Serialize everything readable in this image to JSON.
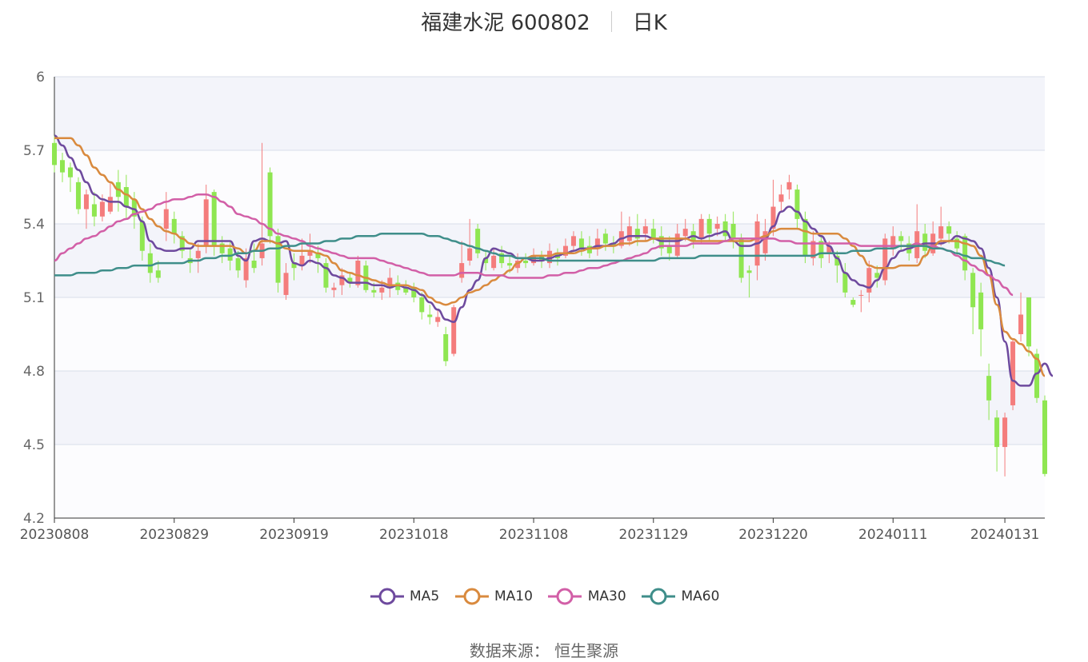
{
  "header": {
    "title": "福建水泥 600802",
    "period": "日K"
  },
  "footer": {
    "source": "数据来源： 恒生聚源"
  },
  "colors": {
    "up": "#f47c7c",
    "down": "#8fe651",
    "ma5": "#6e4a9e",
    "ma10": "#d98a3e",
    "ma30": "#d25fa7",
    "ma60": "#3f8e8a",
    "grid": "#d9deea",
    "band": "#f3f4fa"
  },
  "chart_data": {
    "type": "candlestick",
    "title": "福建水泥 600802",
    "subtitle": "日K",
    "ylim": [
      4.2,
      6.0
    ],
    "yticks": [
      "6",
      "5.7",
      "5.4",
      "5.1",
      "4.8",
      "4.5",
      "4.2"
    ],
    "xticks": [
      {
        "index": 0,
        "label": "20230808"
      },
      {
        "index": 15,
        "label": "20230829"
      },
      {
        "index": 30,
        "label": "20230919"
      },
      {
        "index": 45,
        "label": "20231018"
      },
      {
        "index": 60,
        "label": "20231108"
      },
      {
        "index": 75,
        "label": "20231129"
      },
      {
        "index": 90,
        "label": "20231220"
      },
      {
        "index": 105,
        "label": "20240111"
      },
      {
        "index": 119,
        "label": "20240131"
      }
    ],
    "candles": [
      [
        5.73,
        5.64,
        5.76,
        5.61
      ],
      [
        5.66,
        5.61,
        5.69,
        5.57
      ],
      [
        5.63,
        5.59,
        5.65,
        5.53
      ],
      [
        5.57,
        5.46,
        5.59,
        5.44
      ],
      [
        5.46,
        5.52,
        5.54,
        5.38
      ],
      [
        5.48,
        5.43,
        5.53,
        5.39
      ],
      [
        5.43,
        5.49,
        5.52,
        5.41
      ],
      [
        5.45,
        5.51,
        5.57,
        5.44
      ],
      [
        5.57,
        5.51,
        5.62,
        5.45
      ],
      [
        5.55,
        5.47,
        5.6,
        5.42
      ],
      [
        5.5,
        5.43,
        5.53,
        5.38
      ],
      [
        5.41,
        5.29,
        5.43,
        5.25
      ],
      [
        5.28,
        5.2,
        5.32,
        5.16
      ],
      [
        5.21,
        5.18,
        5.25,
        5.16
      ],
      [
        5.38,
        5.46,
        5.53,
        5.33
      ],
      [
        5.42,
        5.36,
        5.45,
        5.32
      ],
      [
        5.35,
        5.29,
        5.37,
        5.26
      ],
      [
        5.26,
        5.24,
        5.3,
        5.2
      ],
      [
        5.26,
        5.29,
        5.32,
        5.2
      ],
      [
        5.31,
        5.5,
        5.56,
        5.28
      ],
      [
        5.53,
        5.31,
        5.54,
        5.27
      ],
      [
        5.32,
        5.28,
        5.35,
        5.24
      ],
      [
        5.3,
        5.25,
        5.33,
        5.21
      ],
      [
        5.26,
        5.21,
        5.29,
        5.18
      ],
      [
        5.17,
        5.26,
        5.3,
        5.14
      ],
      [
        5.25,
        5.22,
        5.32,
        5.2
      ],
      [
        5.26,
        5.32,
        5.73,
        5.23
      ],
      [
        5.61,
        5.35,
        5.63,
        5.32
      ],
      [
        5.35,
        5.16,
        5.38,
        5.12
      ],
      [
        5.11,
        5.2,
        5.24,
        5.09
      ],
      [
        5.24,
        5.22,
        5.28,
        5.17
      ],
      [
        5.23,
        5.27,
        5.34,
        5.21
      ],
      [
        5.27,
        5.29,
        5.36,
        5.24
      ],
      [
        5.28,
        5.26,
        5.31,
        5.2
      ],
      [
        5.24,
        5.14,
        5.26,
        5.12
      ],
      [
        5.13,
        5.14,
        5.16,
        5.1
      ],
      [
        5.15,
        5.19,
        5.22,
        5.11
      ],
      [
        5.18,
        5.16,
        5.2,
        5.14
      ],
      [
        5.15,
        5.25,
        5.27,
        5.14
      ],
      [
        5.23,
        5.13,
        5.25,
        5.12
      ],
      [
        5.13,
        5.12,
        5.16,
        5.1
      ],
      [
        5.12,
        5.14,
        5.17,
        5.09
      ],
      [
        5.14,
        5.18,
        5.22,
        5.1
      ],
      [
        5.16,
        5.13,
        5.19,
        5.11
      ],
      [
        5.14,
        5.12,
        5.17,
        5.11
      ],
      [
        5.14,
        5.1,
        5.16,
        5.08
      ],
      [
        5.1,
        5.04,
        5.12,
        5.01
      ],
      [
        5.03,
        5.02,
        5.07,
        4.99
      ],
      [
        5.0,
        5.02,
        5.05,
        4.98
      ],
      [
        4.95,
        4.84,
        4.98,
        4.82
      ],
      [
        4.87,
        5.06,
        5.07,
        4.86
      ],
      [
        5.18,
        5.24,
        5.33,
        5.16
      ],
      [
        5.25,
        5.3,
        5.42,
        5.23
      ],
      [
        5.38,
        5.28,
        5.4,
        5.26
      ],
      [
        5.26,
        5.24,
        5.29,
        5.21
      ],
      [
        5.22,
        5.27,
        5.3,
        5.21
      ],
      [
        5.28,
        5.24,
        5.31,
        5.22
      ],
      [
        5.24,
        5.23,
        5.27,
        5.2
      ],
      [
        5.22,
        5.25,
        5.28,
        5.2
      ],
      [
        5.25,
        5.24,
        5.28,
        5.22
      ],
      [
        5.24,
        5.27,
        5.3,
        5.23
      ],
      [
        5.27,
        5.25,
        5.29,
        5.22
      ],
      [
        5.24,
        5.29,
        5.32,
        5.22
      ],
      [
        5.28,
        5.26,
        5.3,
        5.23
      ],
      [
        5.27,
        5.31,
        5.34,
        5.26
      ],
      [
        5.31,
        5.35,
        5.37,
        5.29
      ],
      [
        5.34,
        5.3,
        5.37,
        5.27
      ],
      [
        5.31,
        5.28,
        5.35,
        5.26
      ],
      [
        5.3,
        5.34,
        5.38,
        5.27
      ],
      [
        5.36,
        5.32,
        5.38,
        5.29
      ],
      [
        5.32,
        5.31,
        5.35,
        5.28
      ],
      [
        5.31,
        5.37,
        5.45,
        5.3
      ],
      [
        5.33,
        5.39,
        5.43,
        5.31
      ],
      [
        5.38,
        5.34,
        5.44,
        5.31
      ],
      [
        5.36,
        5.39,
        5.42,
        5.33
      ],
      [
        5.38,
        5.34,
        5.42,
        5.32
      ],
      [
        5.35,
        5.3,
        5.39,
        5.27
      ],
      [
        5.31,
        5.28,
        5.35,
        5.25
      ],
      [
        5.27,
        5.36,
        5.4,
        5.26
      ],
      [
        5.35,
        5.38,
        5.42,
        5.33
      ],
      [
        5.37,
        5.33,
        5.4,
        5.3
      ],
      [
        5.34,
        5.42,
        5.44,
        5.32
      ],
      [
        5.42,
        5.36,
        5.44,
        5.33
      ],
      [
        5.38,
        5.4,
        5.43,
        5.35
      ],
      [
        5.41,
        5.35,
        5.44,
        5.33
      ],
      [
        5.4,
        5.34,
        5.45,
        5.3
      ],
      [
        5.34,
        5.18,
        5.36,
        5.16
      ],
      [
        5.21,
        5.2,
        5.23,
        5.1
      ],
      [
        5.23,
        5.41,
        5.44,
        5.17
      ],
      [
        5.28,
        5.37,
        5.42,
        5.25
      ],
      [
        5.38,
        5.47,
        5.58,
        5.35
      ],
      [
        5.49,
        5.52,
        5.56,
        5.45
      ],
      [
        5.54,
        5.57,
        5.6,
        5.5
      ],
      [
        5.54,
        5.42,
        5.56,
        5.38
      ],
      [
        5.42,
        5.27,
        5.45,
        5.24
      ],
      [
        5.26,
        5.33,
        5.37,
        5.23
      ],
      [
        5.33,
        5.26,
        5.35,
        5.22
      ],
      [
        5.28,
        5.31,
        5.33,
        5.24
      ],
      [
        5.27,
        5.23,
        5.29,
        5.16
      ],
      [
        5.2,
        5.12,
        5.24,
        5.1
      ],
      [
        5.09,
        5.07,
        5.1,
        5.06
      ],
      [
        5.11,
        5.11,
        5.13,
        5.04
      ],
      [
        5.12,
        5.22,
        5.25,
        5.08
      ],
      [
        5.2,
        5.18,
        5.23,
        5.14
      ],
      [
        5.17,
        5.34,
        5.36,
        5.15
      ]
    ],
    "extra_candles": [
      [
        5.3,
        5.35,
        5.39,
        5.27
      ],
      [
        5.35,
        5.33,
        5.37,
        5.29
      ],
      [
        5.32,
        5.28,
        5.35,
        5.25
      ],
      [
        5.26,
        5.37,
        5.48,
        5.24
      ],
      [
        5.36,
        5.29,
        5.4,
        5.26
      ],
      [
        5.28,
        5.36,
        5.41,
        5.27
      ],
      [
        5.34,
        5.39,
        5.47,
        5.31
      ],
      [
        5.39,
        5.36,
        5.41,
        5.32
      ],
      [
        5.34,
        5.3,
        5.37,
        5.27
      ],
      [
        5.35,
        5.21,
        5.36,
        5.17
      ],
      [
        5.2,
        5.06,
        5.22,
        4.95
      ],
      [
        5.12,
        4.97,
        5.16,
        4.86
      ],
      [
        4.78,
        4.68,
        4.83,
        4.6
      ],
      [
        4.61,
        4.49,
        4.64,
        4.39
      ],
      [
        4.49,
        4.61,
        4.63,
        4.37
      ],
      [
        4.66,
        4.92,
        4.93,
        4.64
      ],
      [
        4.95,
        5.03,
        5.12,
        4.92
      ],
      [
        5.1,
        4.9,
        5.1,
        4.86
      ],
      [
        4.87,
        4.69,
        4.89,
        4.67
      ],
      [
        4.68,
        4.38,
        4.7,
        4.37
      ]
    ],
    "series": [
      {
        "name": "MA5",
        "values": [
          5.76,
          5.72,
          5.67,
          5.62,
          5.57,
          5.52,
          5.5,
          5.49,
          5.49,
          5.47,
          5.46,
          5.41,
          5.33,
          5.3,
          5.29,
          5.29,
          5.3,
          5.3,
          5.33,
          5.33,
          5.33,
          5.33,
          5.33,
          5.27,
          5.25,
          5.33,
          5.34,
          5.33,
          5.32,
          5.33,
          5.24,
          5.23,
          5.25,
          5.24,
          5.22,
          5.19,
          5.18,
          5.16,
          5.16,
          5.16,
          5.15,
          5.15,
          5.14,
          5.15,
          5.14,
          5.13,
          5.11,
          5.08,
          5.05,
          5.01,
          5.0,
          5.06,
          5.13,
          5.17,
          5.26,
          5.3,
          5.29,
          5.28,
          5.26,
          5.26,
          5.25,
          5.25,
          5.26,
          5.27,
          5.28,
          5.29,
          5.3,
          5.3,
          5.31,
          5.31,
          5.32,
          5.34,
          5.35,
          5.35,
          5.35,
          5.34,
          5.33,
          5.33,
          5.33,
          5.34,
          5.35,
          5.34,
          5.35,
          5.36,
          5.37,
          5.33,
          5.31,
          5.31,
          5.32,
          5.34,
          5.39,
          5.45,
          5.47,
          5.45,
          5.41,
          5.38,
          5.35,
          5.31,
          5.26,
          5.2,
          5.17,
          5.15,
          5.14,
          5.17,
          5.22,
          5.26,
          5.29,
          5.3,
          5.31,
          5.32,
          5.32,
          5.32,
          5.33,
          5.35,
          5.34,
          5.33,
          5.3,
          5.22,
          5.1,
          4.92,
          4.76,
          4.74,
          4.74,
          4.79,
          4.83,
          4.78
        ]
      },
      {
        "name": "MA10",
        "values": [
          5.75,
          5.75,
          5.75,
          5.72,
          5.68,
          5.63,
          5.6,
          5.57,
          5.54,
          5.52,
          5.5,
          5.46,
          5.42,
          5.39,
          5.37,
          5.36,
          5.34,
          5.32,
          5.31,
          5.31,
          5.31,
          5.31,
          5.31,
          5.3,
          5.28,
          5.29,
          5.33,
          5.33,
          5.32,
          5.3,
          5.29,
          5.29,
          5.29,
          5.28,
          5.27,
          5.24,
          5.21,
          5.2,
          5.19,
          5.18,
          5.17,
          5.16,
          5.15,
          5.15,
          5.15,
          5.14,
          5.13,
          5.1,
          5.08,
          5.07,
          5.08,
          5.1,
          5.12,
          5.13,
          5.15,
          5.17,
          5.19,
          5.21,
          5.24,
          5.26,
          5.27,
          5.27,
          5.27,
          5.28,
          5.28,
          5.28,
          5.29,
          5.3,
          5.3,
          5.31,
          5.31,
          5.32,
          5.32,
          5.33,
          5.33,
          5.34,
          5.34,
          5.34,
          5.34,
          5.34,
          5.33,
          5.33,
          5.33,
          5.33,
          5.33,
          5.33,
          5.33,
          5.33,
          5.34,
          5.35,
          5.37,
          5.38,
          5.38,
          5.38,
          5.37,
          5.36,
          5.36,
          5.36,
          5.36,
          5.34,
          5.31,
          5.27,
          5.23,
          5.22,
          5.22,
          5.22,
          5.23,
          5.23,
          5.23,
          5.27,
          5.31,
          5.33,
          5.33,
          5.33,
          5.32,
          5.31,
          5.27,
          5.19,
          5.07,
          4.96,
          4.93,
          4.91,
          4.88,
          4.85,
          4.78
        ]
      },
      {
        "name": "MA30",
        "values": [
          5.25,
          5.28,
          5.3,
          5.32,
          5.34,
          5.35,
          5.37,
          5.39,
          5.41,
          5.42,
          5.44,
          5.45,
          5.46,
          5.48,
          5.49,
          5.5,
          5.5,
          5.51,
          5.52,
          5.52,
          5.51,
          5.49,
          5.47,
          5.44,
          5.43,
          5.42,
          5.4,
          5.38,
          5.36,
          5.35,
          5.34,
          5.33,
          5.31,
          5.3,
          5.29,
          5.28,
          5.27,
          5.26,
          5.26,
          5.26,
          5.26,
          5.25,
          5.24,
          5.23,
          5.22,
          5.21,
          5.2,
          5.19,
          5.19,
          5.19,
          5.19,
          5.2,
          5.2,
          5.2,
          5.19,
          5.19,
          5.19,
          5.18,
          5.18,
          5.18,
          5.18,
          5.18,
          5.19,
          5.19,
          5.2,
          5.2,
          5.21,
          5.22,
          5.22,
          5.23,
          5.24,
          5.25,
          5.26,
          5.27,
          5.28,
          5.3,
          5.31,
          5.31,
          5.31,
          5.31,
          5.32,
          5.32,
          5.32,
          5.32,
          5.33,
          5.34,
          5.34,
          5.34,
          5.34,
          5.34,
          5.34,
          5.33,
          5.33,
          5.32,
          5.32,
          5.32,
          5.32,
          5.32,
          5.32,
          5.32,
          5.32,
          5.31,
          5.31,
          5.31,
          5.31,
          5.31,
          5.31,
          5.31,
          5.32,
          5.31,
          5.31,
          5.3,
          5.29,
          5.27,
          5.25,
          5.23,
          5.21,
          5.19,
          5.17,
          5.14,
          5.11
        ]
      },
      {
        "name": "MA60",
        "values": [
          5.19,
          5.19,
          5.19,
          5.2,
          5.2,
          5.2,
          5.21,
          5.21,
          5.22,
          5.22,
          5.23,
          5.23,
          5.23,
          5.24,
          5.24,
          5.24,
          5.24,
          5.25,
          5.25,
          5.26,
          5.26,
          5.27,
          5.27,
          5.28,
          5.28,
          5.29,
          5.29,
          5.3,
          5.3,
          5.31,
          5.31,
          5.32,
          5.32,
          5.32,
          5.33,
          5.33,
          5.34,
          5.34,
          5.35,
          5.35,
          5.35,
          5.36,
          5.36,
          5.36,
          5.36,
          5.36,
          5.36,
          5.35,
          5.35,
          5.34,
          5.33,
          5.32,
          5.31,
          5.3,
          5.29,
          5.28,
          5.27,
          5.27,
          5.26,
          5.26,
          5.26,
          5.26,
          5.25,
          5.25,
          5.25,
          5.25,
          5.25,
          5.25,
          5.25,
          5.25,
          5.25,
          5.25,
          5.25,
          5.25,
          5.25,
          5.25,
          5.26,
          5.26,
          5.26,
          5.26,
          5.26,
          5.27,
          5.27,
          5.27,
          5.27,
          5.27,
          5.27,
          5.27,
          5.27,
          5.27,
          5.27,
          5.27,
          5.27,
          5.27,
          5.27,
          5.27,
          5.28,
          5.28,
          5.28,
          5.28,
          5.29,
          5.29,
          5.29,
          5.3,
          5.3,
          5.3,
          5.31,
          5.31,
          5.31,
          5.31,
          5.3,
          5.3,
          5.29,
          5.28,
          5.27,
          5.26,
          5.26,
          5.25,
          5.24,
          5.23
        ]
      }
    ]
  }
}
